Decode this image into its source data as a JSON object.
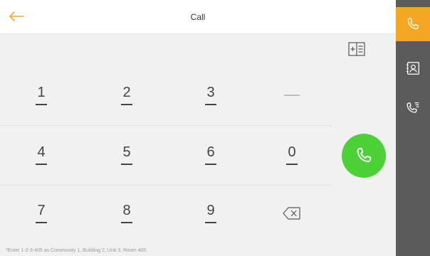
{
  "header": {
    "title": "Call"
  },
  "dialpad": {
    "rows": [
      [
        "1",
        "2",
        "3",
        "—"
      ],
      [
        "4",
        "5",
        "6",
        "0"
      ],
      [
        "7",
        "8",
        "9"
      ]
    ]
  },
  "hint": "*Enter 1-2-3-405 as Community 1, Building 2, Unit 3, Room 405.",
  "sidebar": {
    "items": [
      {
        "icon": "phone-icon",
        "active": true
      },
      {
        "icon": "contacts-icon",
        "active": false
      },
      {
        "icon": "call-log-icon",
        "active": false
      }
    ]
  },
  "colors": {
    "accent": "#f5a623",
    "call": "#4cd137",
    "sidebar": "#5b5b5b",
    "pad_bg": "#f1f1f1"
  }
}
